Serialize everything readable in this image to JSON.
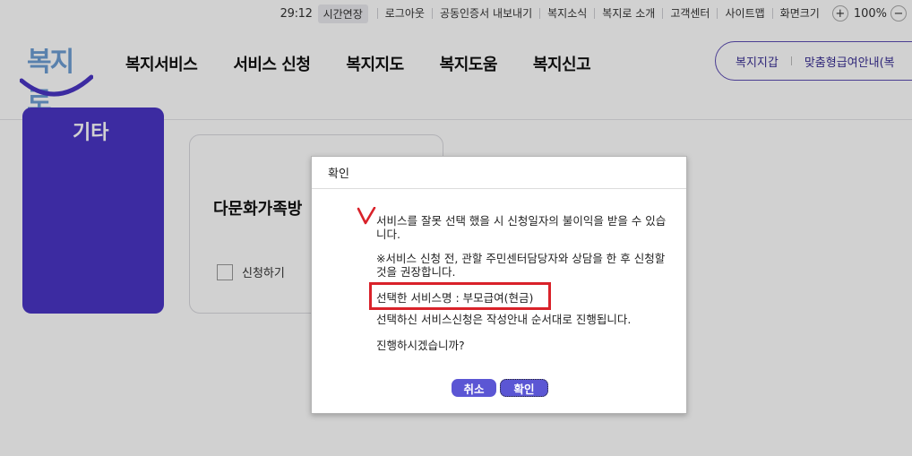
{
  "util_bar": {
    "timer": "29:12",
    "extend_label": "시간연장",
    "links": [
      "로그아웃",
      "공동인증서 내보내기",
      "복지소식",
      "복지로 소개",
      "고객센터",
      "사이트맵",
      "화면크기"
    ],
    "zoom_plus": "+",
    "zoom_level": "100%",
    "zoom_minus": "−"
  },
  "header": {
    "logo_text": "복지로",
    "gnb": [
      "복지서비스",
      "서비스 신청",
      "복지지도",
      "복지도움",
      "복지신고"
    ],
    "quick_links": [
      "복지지갑",
      "맞춤형급여안내(복"
    ]
  },
  "side_card": {
    "title": "기타"
  },
  "service_card": {
    "title": "다문화가족방",
    "apply_label": "신청하기"
  },
  "dialog": {
    "title": "확인",
    "messages": [
      "서비스를 잘못 선택 했을 시 신청일자의 불이익을 받을 수 있습니다.",
      "※서비스 신청 전, 관할 주민센터담당자와 상담을 한 후 신청할 것을 권장합니다.",
      "선택한 서비스명 : 부모급여(현금)",
      "선택하신 서비스신청은 작성안내 순서대로 진행됩니다.",
      "진행하시겠습니까?"
    ],
    "cancel_label": "취소",
    "confirm_label": "확인"
  },
  "colors": {
    "brand_purple": "#4a35c5",
    "button_purple": "#5b56d4",
    "highlight_red": "#d9222a",
    "logo_blue": "#6d9ed4"
  }
}
